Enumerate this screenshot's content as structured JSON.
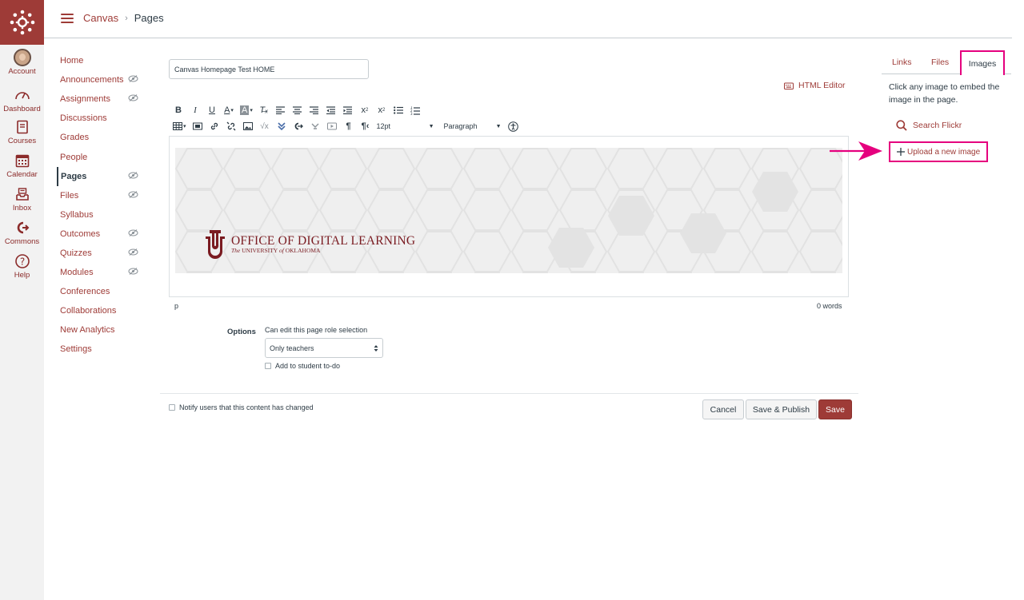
{
  "global_nav": {
    "items": [
      {
        "label": "Account",
        "icon": "avatar"
      },
      {
        "label": "Dashboard",
        "icon": "dashboard-icon"
      },
      {
        "label": "Courses",
        "icon": "courses-icon"
      },
      {
        "label": "Calendar",
        "icon": "calendar-icon"
      },
      {
        "label": "Inbox",
        "icon": "inbox-icon"
      },
      {
        "label": "Commons",
        "icon": "commons-icon"
      },
      {
        "label": "Help",
        "icon": "help-icon"
      }
    ],
    "brand_color": "#9e3b37"
  },
  "header": {
    "breadcrumb": [
      "Canvas",
      "Pages"
    ]
  },
  "course_nav": {
    "items": [
      {
        "label": "Home",
        "hidden": false,
        "active": false
      },
      {
        "label": "Announcements",
        "hidden": true,
        "active": false
      },
      {
        "label": "Assignments",
        "hidden": true,
        "active": false
      },
      {
        "label": "Discussions",
        "hidden": false,
        "active": false
      },
      {
        "label": "Grades",
        "hidden": false,
        "active": false
      },
      {
        "label": "People",
        "hidden": false,
        "active": false
      },
      {
        "label": "Pages",
        "hidden": true,
        "active": true
      },
      {
        "label": "Files",
        "hidden": true,
        "active": false
      },
      {
        "label": "Syllabus",
        "hidden": false,
        "active": false
      },
      {
        "label": "Outcomes",
        "hidden": true,
        "active": false
      },
      {
        "label": "Quizzes",
        "hidden": true,
        "active": false
      },
      {
        "label": "Modules",
        "hidden": true,
        "active": false
      },
      {
        "label": "Conferences",
        "hidden": false,
        "active": false
      },
      {
        "label": "Collaborations",
        "hidden": false,
        "active": false
      },
      {
        "label": "New Analytics",
        "hidden": false,
        "active": false
      },
      {
        "label": "Settings",
        "hidden": false,
        "active": false
      }
    ]
  },
  "editor": {
    "title_value": "Canvas Homepage Test HOME",
    "html_editor_label": "HTML Editor",
    "font_size": "12pt",
    "block_format": "Paragraph",
    "status_path": "p",
    "word_count": "0 words",
    "banner": {
      "title": "OFFICE OF DIGITAL LEARNING",
      "subtitle_the": "The",
      "subtitle_univ": "UNIVERSITY",
      "subtitle_of": "of",
      "subtitle_state": "OKLAHOMA"
    }
  },
  "options": {
    "label": "Options",
    "role_label": "Can edit this page role selection",
    "role_value": "Only teachers",
    "todo_label": "Add to student to-do"
  },
  "footer": {
    "notify_label": "Notify users that this content has changed",
    "cancel": "Cancel",
    "save_publish": "Save & Publish",
    "save": "Save"
  },
  "sidebar": {
    "tabs": [
      "Links",
      "Files",
      "Images"
    ],
    "selected_tab": "Images",
    "hint": "Click any image to embed the image in the page.",
    "search_flickr": "Search Flickr",
    "upload": "Upload a new image",
    "highlight_color": "#e5007e"
  }
}
